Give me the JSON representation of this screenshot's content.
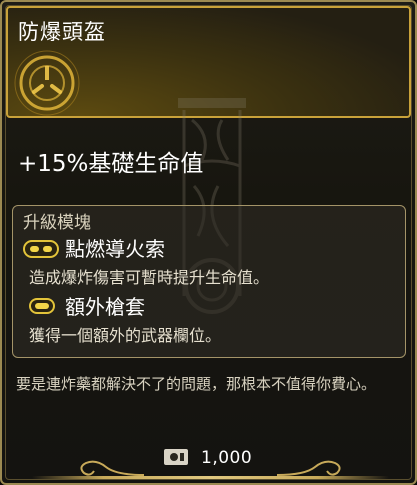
{
  "item": {
    "name": "防爆頭盔",
    "stat": "+15%基礎生命值",
    "emblem_icon": "sun-emblem-icon",
    "accent_color": "#c9a23a"
  },
  "upgrades": {
    "title": "升級模塊",
    "perks": [
      {
        "name": "點燃導火索",
        "description": "造成爆炸傷害可暫時提升生命值。",
        "icon": "double-slot-module-icon"
      },
      {
        "name": "額外槍套",
        "description": "獲得一個額外的武器欄位。",
        "icon": "single-slot-module-icon"
      }
    ]
  },
  "flavor_text": "要是連炸藥都解決不了的問題，那根本不值得你費心。",
  "price": {
    "value": "1,000",
    "icon": "cash-icon"
  }
}
